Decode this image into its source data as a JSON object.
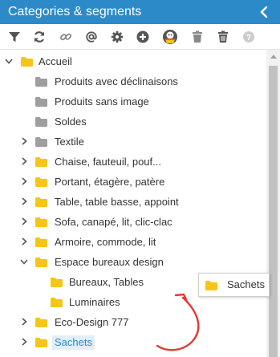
{
  "panel": {
    "title": "Categories & segments",
    "collapse_icon": "chevron-left-icon"
  },
  "toolbar": {
    "buttons": [
      {
        "name": "filter-icon"
      },
      {
        "name": "refresh-icon"
      },
      {
        "name": "link-icon"
      },
      {
        "name": "at-icon"
      },
      {
        "name": "gear-icon"
      },
      {
        "name": "add-icon"
      },
      {
        "name": "user-badge-icon"
      },
      {
        "name": "trash-icon"
      },
      {
        "name": "trash-all-icon"
      },
      {
        "name": "help-icon"
      }
    ]
  },
  "colors": {
    "header": "#2d8ac8",
    "folder_yellow": "#f5c518",
    "folder_grey": "#9e9e9e",
    "selected_text": "#2d8ac8",
    "arrow_red": "#e53935"
  },
  "tree": {
    "root": {
      "label": "Accueil",
      "expanded": true
    },
    "items": [
      {
        "label": "Produits avec déclinaisons",
        "folder": "grey",
        "has_children": false
      },
      {
        "label": "Produits sans image",
        "folder": "grey",
        "has_children": false
      },
      {
        "label": "Soldes",
        "folder": "grey",
        "has_children": false
      },
      {
        "label": "Textile",
        "folder": "grey",
        "has_children": true
      },
      {
        "label": "Chaise, fauteuil, pouf...",
        "folder": "yellow",
        "has_children": true
      },
      {
        "label": "Portant, étagère, patère",
        "folder": "yellow",
        "has_children": true
      },
      {
        "label": "Table, table basse, appoint",
        "folder": "yellow",
        "has_children": true
      },
      {
        "label": "Sofa, canapé, lit, clic-clac",
        "folder": "yellow",
        "has_children": true
      },
      {
        "label": "Armoire, commode, lit",
        "folder": "yellow",
        "has_children": true
      },
      {
        "label": "Espace bureaux design",
        "folder": "yellow",
        "has_children": true,
        "expanded": true
      },
      {
        "label": "Bureaux, Tables",
        "folder": "yellow",
        "has_children": false,
        "child": true
      },
      {
        "label": "Luminaires",
        "folder": "yellow",
        "has_children": false,
        "child": true
      },
      {
        "label": "Eco-Design 777",
        "folder": "yellow",
        "has_children": true
      },
      {
        "label": "Sachets",
        "folder": "yellow",
        "has_children": true,
        "selected": true
      }
    ]
  },
  "drag_proxy": {
    "label": "Sachets"
  }
}
